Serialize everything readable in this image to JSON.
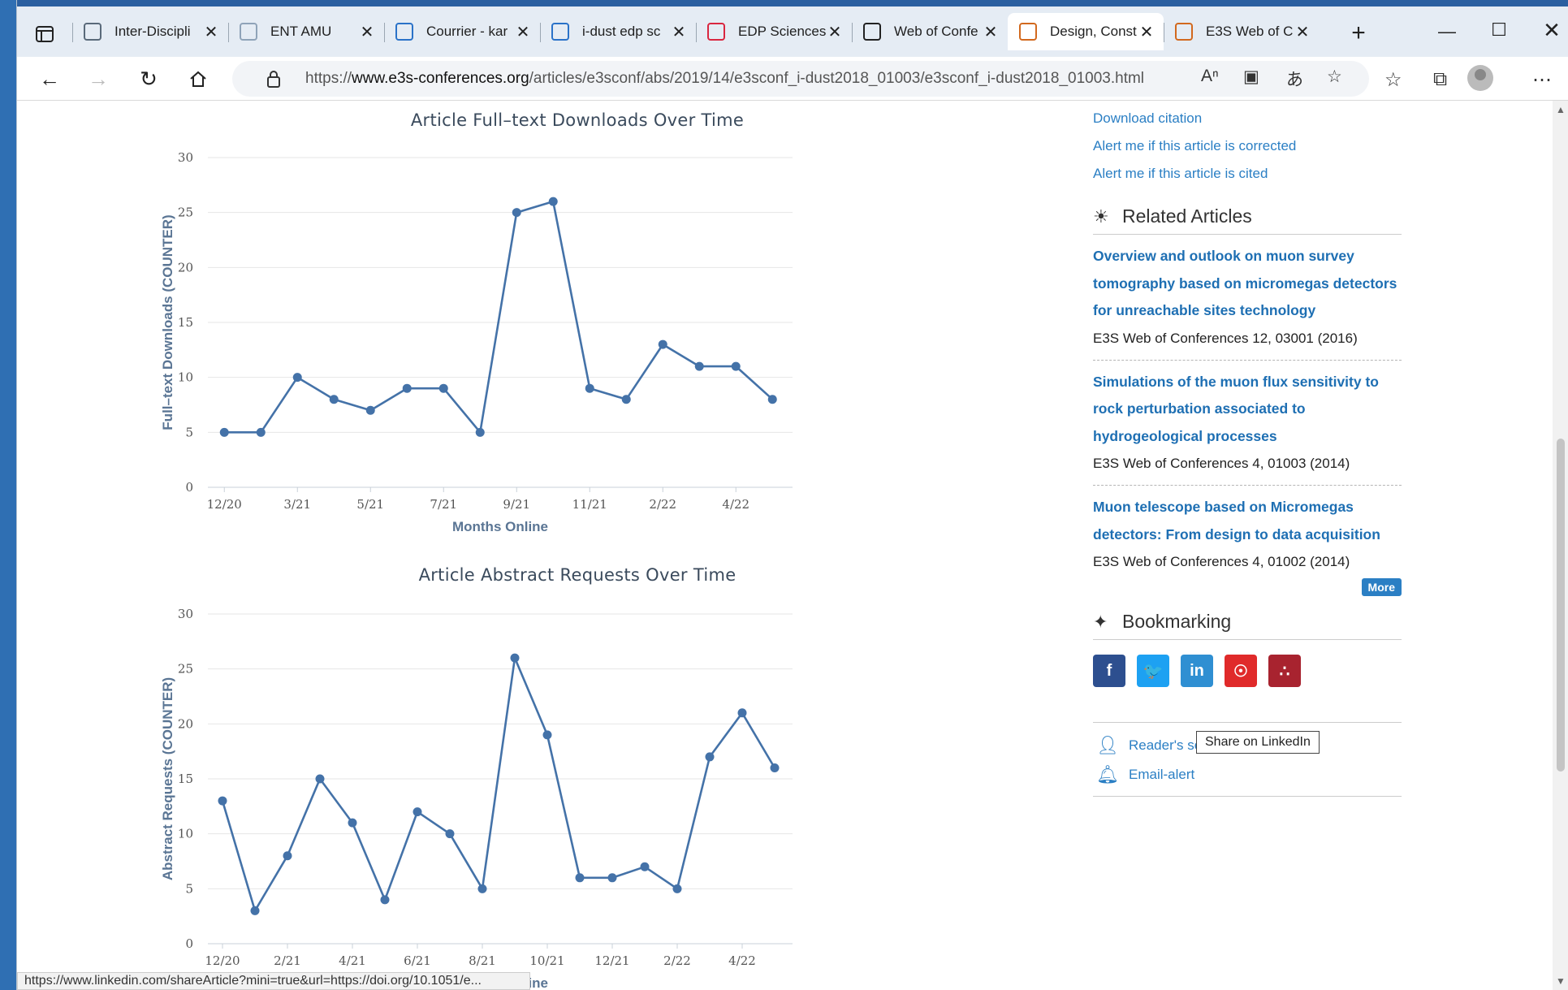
{
  "browser": {
    "tabs": [
      {
        "title": "Inter-Discipli",
        "favicon": "circle-logo-icon",
        "favicon_color": "#5a6a7a",
        "active": false
      },
      {
        "title": "ENT AMU",
        "favicon": "ent-icon",
        "favicon_color": "#8fa3b8",
        "active": false
      },
      {
        "title": "Courrier - kar",
        "favicon": "outlook-icon",
        "favicon_color": "#2a72c8",
        "active": false
      },
      {
        "title": "i-dust edp sc",
        "favicon": "search-icon",
        "favicon_color": "#2a72c8",
        "active": false
      },
      {
        "title": "EDP Sciences",
        "favicon": "edp-icon",
        "favicon_color": "#d9263f",
        "active": false
      },
      {
        "title": "Web of Confe",
        "favicon": "swirl-icon",
        "favicon_color": "#222222",
        "active": false
      },
      {
        "title": "Design, Const",
        "favicon": "e3s-icon",
        "favicon_color": "#d2691e",
        "active": true
      },
      {
        "title": "E3S Web of C",
        "favicon": "e3s-icon",
        "favicon_color": "#d2691e",
        "active": false
      }
    ],
    "url_prefix": "https://",
    "url_host": "www.e3s-conferences.org",
    "url_path": "/articles/e3sconf/abs/2019/14/e3sconf_i-dust2018_01003/e3sconf_i-dust2018_01003.html",
    "status_url": "https://www.linkedin.com/shareArticle?mini=true&url=https://doi.org/10.1051/e..."
  },
  "charts": {
    "downloads": {
      "title": "Article Full–text Downloads Over Time",
      "xlabel": "Months Online",
      "ylabel": "Full–text Downloads (COUNTER)"
    },
    "abstracts": {
      "title": "Article Abstract Requests Over Time",
      "xlabel": "Months Online",
      "ylabel": "Abstract Requests (COUNTER)"
    }
  },
  "chart_data": [
    {
      "type": "line",
      "title": "Article Full–text Downloads Over Time",
      "xlabel": "Months Online",
      "ylabel": "Full–text Downloads (COUNTER)",
      "ylim": [
        0,
        30
      ],
      "yticks": [
        0,
        5,
        10,
        15,
        20,
        25,
        30
      ],
      "grid": true,
      "color": "#4472a8",
      "x_ticks": [
        "12/20",
        "3/21",
        "5/21",
        "7/21",
        "9/21",
        "11/21",
        "2/22",
        "4/22"
      ],
      "x_tick_index": [
        0,
        2,
        4,
        6,
        8,
        10,
        12,
        14
      ],
      "values": [
        5,
        5,
        10,
        8,
        7,
        9,
        9,
        5,
        25,
        26,
        9,
        8,
        13,
        11,
        11,
        8
      ]
    },
    {
      "type": "line",
      "title": "Article Abstract Requests Over Time",
      "xlabel": "Months Online",
      "ylabel": "Abstract Requests (COUNTER)",
      "ylim": [
        0,
        30
      ],
      "yticks": [
        0,
        5,
        10,
        15,
        20,
        25,
        30
      ],
      "grid": true,
      "color": "#4472a8",
      "x_ticks": [
        "12/20",
        "2/21",
        "4/21",
        "6/21",
        "8/21",
        "10/21",
        "12/21",
        "2/22",
        "4/22"
      ],
      "x_tick_index": [
        0,
        2,
        4,
        6,
        8,
        10,
        12,
        14,
        16
      ],
      "values": [
        13,
        3,
        8,
        15,
        11,
        4,
        12,
        10,
        5,
        26,
        19,
        6,
        6,
        7,
        5,
        17,
        21,
        16
      ]
    }
  ],
  "sidebar": {
    "links": [
      "Download citation",
      "Alert me if this article is corrected",
      "Alert me if this article is cited"
    ],
    "related_heading": "Related Articles",
    "related": [
      {
        "title": "Overview and outlook on muon survey tomography based on micromegas detectors for unreachable sites technology",
        "source": "E3S Web of Conferences 12, 03001 (2016)"
      },
      {
        "title": "Simulations of the muon flux sensitivity to rock perturbation associated to hydrogeological processes",
        "source": "E3S Web of Conferences 4, 01003 (2014)"
      },
      {
        "title": "Muon telescope based on Micromegas detectors: From design to data acquisition",
        "source": "E3S Web of Conferences 4, 01002 (2014)"
      }
    ],
    "more_label": "More",
    "bookmark_heading": "Bookmarking",
    "share_buttons": [
      {
        "name": "facebook",
        "glyph": "f",
        "color": "#2d4f8f"
      },
      {
        "name": "twitter",
        "glyph": "🐦",
        "color": "#1da1f2"
      },
      {
        "name": "linkedin",
        "glyph": "in",
        "color": "#2f8fd2"
      },
      {
        "name": "weibo",
        "glyph": "☉",
        "color": "#e02a2a"
      },
      {
        "name": "mendeley",
        "glyph": "∴",
        "color": "#a8232f"
      }
    ],
    "tooltip": "Share on LinkedIn",
    "services": [
      {
        "label": "Reader's services",
        "icon": "user-icon"
      },
      {
        "label": "Email-alert",
        "icon": "bell-icon"
      }
    ]
  }
}
